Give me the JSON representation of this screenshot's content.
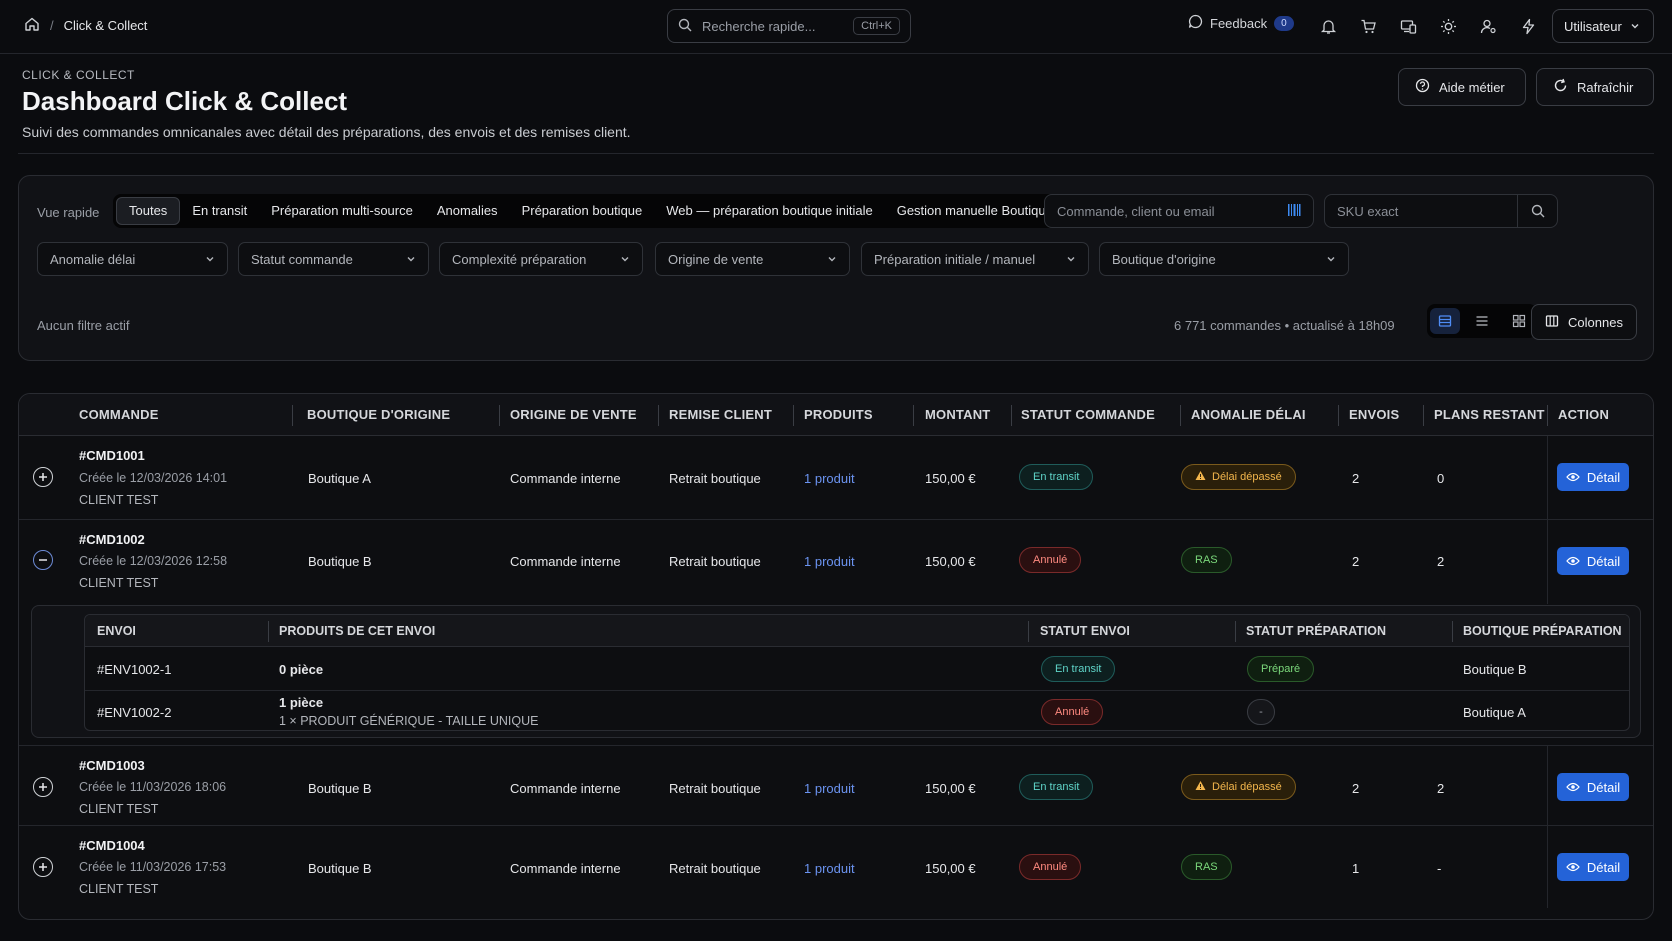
{
  "breadcrumb": {
    "current": "Click & Collect"
  },
  "search": {
    "placeholder": "Recherche rapide...",
    "shortcut": "Ctrl+K"
  },
  "topbar": {
    "feedback_label": "Feedback",
    "feedback_count": "0",
    "user_label": "Utilisateur"
  },
  "header": {
    "eyebrow": "CLICK & COLLECT",
    "title": "Dashboard Click & Collect",
    "subtitle": "Suivi des commandes omnicanales avec détail des préparations, des envois et des remises client.",
    "help_label": "Aide métier",
    "refresh_label": "Rafraîchir"
  },
  "filters": {
    "quick_label": "Vue rapide",
    "quick_views": [
      "Toutes",
      "En transit",
      "Préparation multi-source",
      "Anomalies",
      "Préparation boutique",
      "Web — préparation boutique initiale",
      "Gestion manuelle Boutique"
    ],
    "order_search_placeholder": "Commande, client ou email",
    "sku_placeholder": "SKU exact",
    "selects": [
      "Anomalie délai",
      "Statut commande",
      "Complexité préparation",
      "Origine de vente",
      "Préparation initiale / manuel",
      "Boutique d'origine"
    ],
    "no_filter": "Aucun filtre actif",
    "count_text": "6 771 commandes • actualisé à 18h09",
    "columns_label": "Colonnes"
  },
  "table": {
    "headers": [
      "Commande",
      "Boutique d'origine",
      "Origine de vente",
      "Remise client",
      "Produits",
      "Montant",
      "Statut commande",
      "Anomalie délai",
      "Envois",
      "Plans restant",
      "Action"
    ],
    "detail_label": "Détail",
    "rows": [
      {
        "id": "#CMD1001",
        "created": "Créée le 12/03/2026 14:01",
        "client": "CLIENT TEST",
        "boutique": "Boutique A",
        "origine": "Commande interne",
        "remise": "Retrait boutique",
        "produits": "1 produit",
        "montant": "150,00 €",
        "statut": "En transit",
        "anomalie": "Délai dépassé",
        "envois": "2",
        "plans": "0"
      },
      {
        "id": "#CMD1002",
        "created": "Créée le 12/03/2026 12:58",
        "client": "CLIENT TEST",
        "boutique": "Boutique B",
        "origine": "Commande interne",
        "remise": "Retrait boutique",
        "produits": "1 produit",
        "montant": "150,00 €",
        "statut": "Annulé",
        "anomalie": "RAS",
        "envois": "2",
        "plans": "2"
      },
      {
        "id": "#CMD1003",
        "created": "Créée le 11/03/2026 18:06",
        "client": "CLIENT TEST",
        "boutique": "Boutique B",
        "origine": "Commande interne",
        "remise": "Retrait boutique",
        "produits": "1 produit",
        "montant": "150,00 €",
        "statut": "En transit",
        "anomalie": "Délai dépassé",
        "envois": "2",
        "plans": "2"
      },
      {
        "id": "#CMD1004",
        "created": "Créée le 11/03/2026 17:53",
        "client": "CLIENT TEST",
        "boutique": "Boutique B",
        "origine": "Commande interne",
        "remise": "Retrait boutique",
        "produits": "1 produit",
        "montant": "150,00 €",
        "statut": "Annulé",
        "anomalie": "RAS",
        "envois": "1",
        "plans": "-"
      }
    ]
  },
  "subtable": {
    "headers": [
      "Envoi",
      "Produits de cet envoi",
      "Statut envoi",
      "Statut préparation",
      "Boutique préparation"
    ],
    "rows": [
      {
        "envoi": "#ENV1002-1",
        "produits": "0 pièce",
        "detail": "",
        "statut": "En transit",
        "preparation": "Préparé",
        "boutique": "Boutique B"
      },
      {
        "envoi": "#ENV1002-2",
        "produits": "1 pièce",
        "detail": "1 × PRODUIT GÉNÉRIQUE - TAILLE UNIQUE",
        "statut": "Annulé",
        "preparation": "-",
        "boutique": "Boutique A"
      }
    ]
  }
}
